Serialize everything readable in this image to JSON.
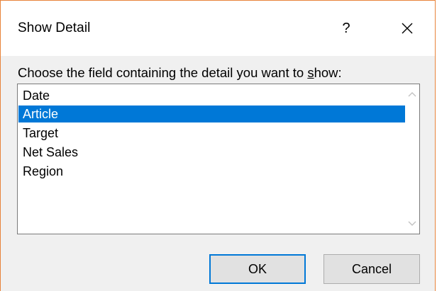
{
  "dialog": {
    "title": "Show Detail",
    "help_label": "?",
    "close_label": "×",
    "prompt": {
      "before": "Choose the field containing the detail you want to ",
      "accel": "s",
      "after": "how:"
    },
    "fields": [
      "Date",
      "Article",
      "Target",
      "Net Sales",
      "Region"
    ],
    "selected_index": 1,
    "buttons": {
      "ok": "OK",
      "cancel": "Cancel"
    }
  },
  "colors": {
    "accent": "#0078d7",
    "border": "#e8833a"
  }
}
